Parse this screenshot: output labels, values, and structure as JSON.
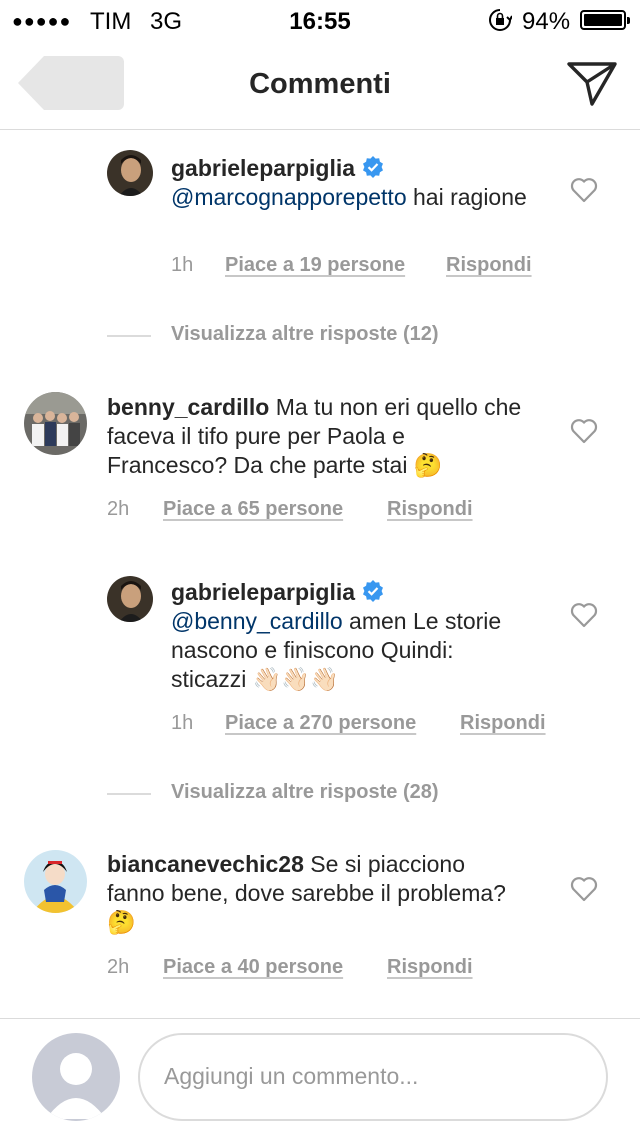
{
  "status": {
    "dots": "●●●●●",
    "carrier": "TIM",
    "network": "3G",
    "time": "16:55",
    "battery": "94%"
  },
  "header": {
    "title": "Commenti"
  },
  "comments": [
    {
      "user": "gabrieleparpiglia",
      "verified": true,
      "mention": "@marcognapporepetto",
      "text": " hai ragione",
      "time": "1h",
      "likes": "Piace a 19 persone",
      "reply": "Rispondi"
    },
    {
      "user": "benny_cardillo",
      "text": "Ma tu non eri quello che faceva il tifo pure per Paola e Francesco? Da che parte stai 🤔",
      "time": "2h",
      "likes": "Piace a 65 persone",
      "reply": "Rispondi"
    },
    {
      "user": "gabrieleparpiglia",
      "verified": true,
      "mention": "@benny_cardillo",
      "text": " amen Le storie nascono e finiscono Quindi: sticazzi 👋🏻👋🏻👋🏻",
      "time": "1h",
      "likes": "Piace a 270 persone",
      "reply": "Rispondi"
    },
    {
      "user": "biancanevechic28",
      "text": "Se si piacciono fanno bene, dove sarebbe il problema? 🤔",
      "time": "2h",
      "likes": "Piace a 40 persone",
      "reply": "Rispondi"
    }
  ],
  "more_replies": [
    "Visualizza altre risposte (12)",
    "Visualizza altre risposte (28)"
  ],
  "input": {
    "placeholder": "Aggiungi un commento..."
  },
  "colors": {
    "mention": "#003569",
    "verified": "#3897f0",
    "meta": "#999999",
    "divider": "#dbdbdb"
  }
}
